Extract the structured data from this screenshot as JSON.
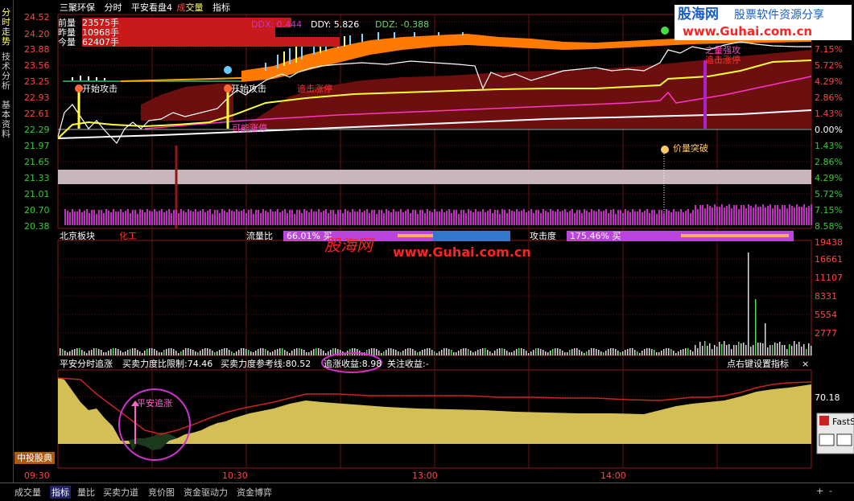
{
  "title_bar": {
    "stock_name": "三聚环保",
    "mode": "分时",
    "indicator_name": "平安看盘4",
    "sub1": "成",
    "sub2": "交量",
    "sub3": "指标"
  },
  "volume_info": {
    "rows": [
      {
        "label": "前量",
        "value": "23575手"
      },
      {
        "label": "昨量",
        "value": "10968手"
      },
      {
        "label": "今量",
        "value": "62407手"
      }
    ]
  },
  "ddx": {
    "ddx": "DDX: 0.444",
    "ddy": "DDY: 5.826",
    "ddz": "DDZ: -0.388"
  },
  "price_axis_left": [
    "24.52",
    "24.20",
    "23.88",
    "23.56",
    "23.25",
    "22.93",
    "22.61",
    "22.29",
    "21.97",
    "21.65",
    "21.33",
    "21.01",
    "20.70",
    "20.38"
  ],
  "pct_axis_right": [
    "8.58%",
    "7.15%",
    "5.72%",
    "4.29%",
    "2.86%",
    "1.43%",
    "0.00%",
    "1.43%",
    "2.86%",
    "4.29%",
    "5.72%",
    "7.15%",
    "8.58%"
  ],
  "annotations": {
    "start_attack_1": "开始攻击",
    "start_attack_2": "开始攻击",
    "chase_limit_up_mid": "追击涨停",
    "possible_limit_up": "可能涨停",
    "chase_limit_up_right": "追击涨停",
    "dragon_attack": "之量强攻",
    "volume_break": "价量突破"
  },
  "sector_bar": {
    "sector": "北京板块",
    "industry": "化工",
    "flow_label": "流量比",
    "flow_value": "66.01% 买",
    "attack_label": "攻击度",
    "attack_value": "175.46% 买"
  },
  "watermark": {
    "brand": "股海网",
    "url": "www.Guhai.com.cn"
  },
  "logo": {
    "brand": "股海网",
    "slogan": "股票软件资源分享",
    "url": "www.Guhai.com.cn"
  },
  "volume_axis": [
    "19438",
    "16661",
    "11107",
    "8331",
    "5554",
    "2777"
  ],
  "lower_panel": {
    "name": "平安分时追涨",
    "buy_limit": "买卖力度比限制:74.46",
    "buy_ref": "买卖力度参考线:80.52",
    "chase_profit": "追涨收益:8.98",
    "focus_profit": "关注收益:-",
    "right_hint": "点右键设置指标",
    "close": "×",
    "value": "70.18",
    "signal": "平安追涨"
  },
  "time_axis": [
    "09:30",
    "10:30",
    "13:00",
    "14:00"
  ],
  "sidebar_tabs": [
    {
      "label": "分时走势",
      "active": true
    },
    {
      "label": "技术分析",
      "active": false
    },
    {
      "label": "基本资料",
      "active": false
    }
  ],
  "zhongtou": "中投股典",
  "fasts": "FastS",
  "bottom_tabs": [
    "成交量",
    "指标",
    "量比",
    "买卖力道",
    "竞价图",
    "资金驱动力",
    "资金博弈"
  ],
  "bottom_right": {
    "plus": "+",
    "minus": "-"
  }
}
